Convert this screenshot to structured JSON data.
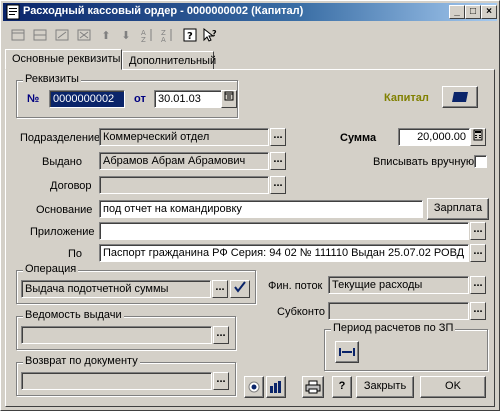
{
  "window": {
    "title": "Расходный кассовый ордер - 0000000002 (Капитал)",
    "minimize_label": "_",
    "maximize_label": "□",
    "close_label": "×"
  },
  "tabs": [
    {
      "label": "Основные реквизиты"
    },
    {
      "label": "Дополнительный"
    }
  ],
  "requisites": {
    "group_label": "Реквизиты",
    "number_label": "№",
    "number_value": "0000000002",
    "date_label": "от",
    "date_value": "30.01.03",
    "firm_label": "Капитал"
  },
  "form": {
    "department_label": "Подразделение",
    "department_value": "Коммерческий отдел",
    "issued_label": "Выдано",
    "issued_value": "Абрамов Абрам Абрамович",
    "contract_label": "Договор",
    "contract_value": "",
    "basis_label": "Основание",
    "basis_value": "под отчет на командировку",
    "salary_button": "Зарплата",
    "attachment_label": "Приложение",
    "attachment_value": "",
    "by_label": "По",
    "by_value": "Паспорт гражданина РФ Серия: 94 02 № 111110 Выдан 25.07.02 РОВД",
    "sum_label": "Сумма",
    "sum_value": "20,000.00",
    "manual_label": "Вписывать вручную",
    "manual_checked": false
  },
  "operation": {
    "group_label": "Операция",
    "value": "Выдача подотчетной суммы"
  },
  "fin_flow": {
    "label": "Фин. поток",
    "value": "Текущие расходы"
  },
  "subconto": {
    "label": "Субконто",
    "value": ""
  },
  "statement": {
    "group_label": "Ведомость выдачи",
    "value": ""
  },
  "return_doc": {
    "group_label": "Возврат по документу",
    "value": ""
  },
  "period": {
    "group_label": "Период расчетов по ЗП"
  },
  "footer": {
    "close_label": "Закрыть",
    "ok_label": "OK",
    "help_label": "?"
  },
  "lookup_label": "...",
  "colors": {
    "title_start": "#0a246a",
    "firm_label": "#808000",
    "face": "#d4d0c8"
  }
}
